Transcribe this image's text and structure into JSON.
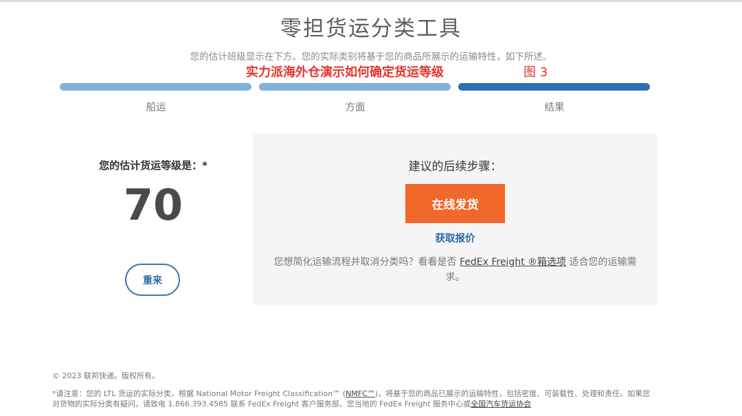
{
  "header": {
    "title": "零担货运分类工具",
    "subtitle": "您的估计班级显示在下方。您的实际类别将基于您的商品所展示的运输特性，如下所述。"
  },
  "overlay": {
    "caption": "实力派海外仓演示如何确定货运等级",
    "figure_label": "图 3",
    "color": "#e8322c"
  },
  "steps": [
    {
      "label": "船运",
      "state": "done"
    },
    {
      "label": "方面",
      "state": "done"
    },
    {
      "label": "结果",
      "state": "active"
    }
  ],
  "result": {
    "heading": "您的估计货运等级是：*",
    "grade": "70",
    "restart_label": "重来"
  },
  "next_steps": {
    "heading": "建议的后续步骤：",
    "ship_online_label": "在线发货",
    "get_quote_label": "获取报价",
    "note_prefix": "您想简化运输流程并取消分类吗？看看是否",
    "note_link": "FedEx Freight ®箱选项",
    "note_suffix": "适合您的运输需求。"
  },
  "footer": {
    "copyright": "© 2023 联邦快递。版权所有。",
    "footnote_part1": "*请注意：您的 LTL 货运的实际分类，根据 National Motor Freight Classification™ (",
    "footnote_nmfc": "NMFC™",
    "footnote_part2": ")，将基于您的商品已展示的运输特性，包括密度、可装载性、处理和责任。如果您对货物的实际分类有疑问，请致电 1.866.393.4585 联系 FedEx Freight 客户服务部、您当地的 FedEx Freight 服务中心或",
    "footnote_link": "全国汽车货运协会"
  },
  "colors": {
    "accent_orange": "#f0682a",
    "step_done": "#7fb3dc",
    "step_active": "#2f6faf",
    "link_blue": "#2e6aa3"
  }
}
